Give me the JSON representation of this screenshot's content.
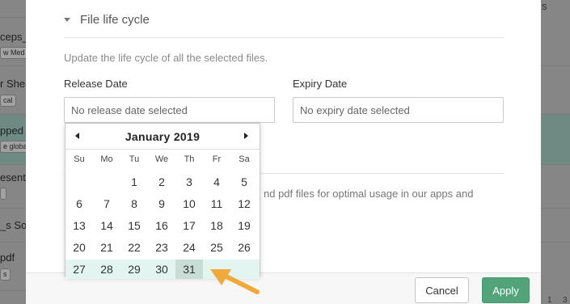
{
  "background_left": {
    "rows": [
      {
        "text": "ceps_",
        "tag": "w Med"
      },
      {
        "text": "r Shea",
        "tag": "cal"
      },
      {
        "text": "pped C",
        "tag": "e globa"
      },
      {
        "text": "esenta",
        "tag": ""
      },
      {
        "text": "_s So",
        "tag": ""
      },
      {
        "text": "pdf",
        "tag": "s"
      }
    ]
  },
  "background_right": {
    "text": "s",
    "num1": "1",
    "num2": "3"
  },
  "modal": {
    "section_title": "File life cycle",
    "description": "Update the life cycle of all the selected files.",
    "release_label": "Release Date",
    "release_placeholder": "No release date selected",
    "expiry_label": "Expiry Date",
    "expiry_placeholder": "No expiry date selected",
    "partial_text": "nd pdf files for optimal usage in our apps and",
    "cancel_label": "Cancel",
    "apply_label": "Apply"
  },
  "datepicker": {
    "month_title": "January 2019",
    "weekdays": [
      "Su",
      "Mo",
      "Tu",
      "We",
      "Th",
      "Fr",
      "Sa"
    ],
    "weeks": [
      [
        "",
        "",
        "1",
        "2",
        "3",
        "4",
        "5"
      ],
      [
        "6",
        "7",
        "8",
        "9",
        "10",
        "11",
        "12"
      ],
      [
        "13",
        "14",
        "15",
        "16",
        "17",
        "18",
        "19"
      ],
      [
        "20",
        "21",
        "22",
        "23",
        "24",
        "25",
        "26"
      ],
      [
        "27",
        "28",
        "29",
        "30",
        "31",
        "",
        ""
      ]
    ],
    "selected_day": "31",
    "highlight_color": "#e3f5f1",
    "selected_color": "#c9ddd7"
  },
  "annotation": {
    "icon": "arrow-icon",
    "color": "#f2a93b"
  }
}
